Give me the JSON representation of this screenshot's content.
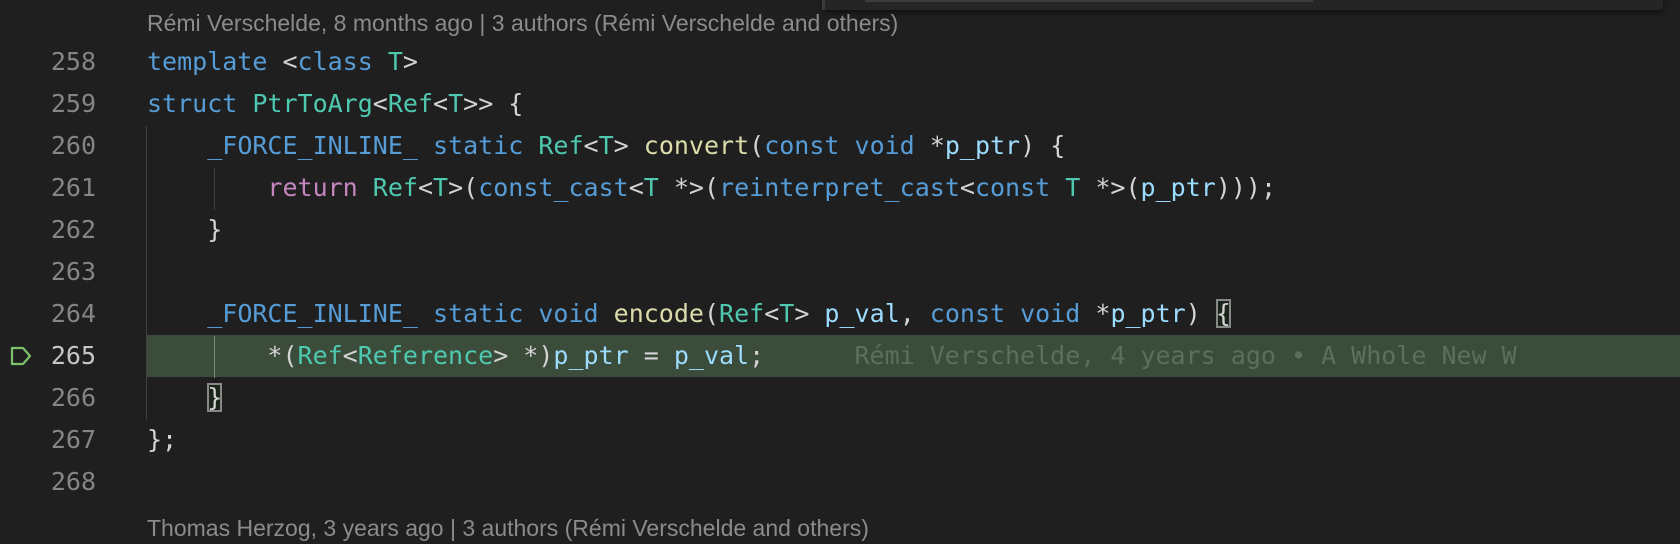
{
  "editor": {
    "blame_header_top": "Rémi Verschelde, 8 months ago | 3 authors (Rémi Verschelde and others)",
    "blame_header_bottom": "Thomas Herzog, 3 years ago | 3 authors (Rémi Verschelde and others)",
    "inline_blame": "Rémi Verschelde, 4 years ago • A Whole New W",
    "current_line": 265,
    "colors": {
      "background": "#1f1f1f",
      "highlight_line": "#3b4c3a",
      "keyword": "#569cd6",
      "type": "#4ec9b0",
      "function": "#dcdcaa",
      "control": "#c586c0",
      "variable": "#9cdcfe",
      "gutter_indicator": "#7ec16e"
    },
    "lines": [
      {
        "number": "258",
        "tokens": [
          [
            "kw",
            "template"
          ],
          [
            "pn",
            " <"
          ],
          [
            "kw",
            "class"
          ],
          [
            "pn",
            " "
          ],
          [
            "ty",
            "T"
          ],
          [
            "pn",
            ">"
          ]
        ]
      },
      {
        "number": "259",
        "tokens": [
          [
            "kw",
            "struct"
          ],
          [
            "pn",
            " "
          ],
          [
            "ty",
            "PtrToArg"
          ],
          [
            "pn",
            "<"
          ],
          [
            "ty",
            "Ref"
          ],
          [
            "pn",
            "<"
          ],
          [
            "ty",
            "T"
          ],
          [
            "pn",
            ">> {"
          ]
        ]
      },
      {
        "number": "260",
        "tokens": [
          [
            "pn",
            "    "
          ],
          [
            "kw",
            "_FORCE_INLINE_"
          ],
          [
            "pn",
            " "
          ],
          [
            "kw",
            "static"
          ],
          [
            "pn",
            " "
          ],
          [
            "ty",
            "Ref"
          ],
          [
            "pn",
            "<"
          ],
          [
            "ty",
            "T"
          ],
          [
            "pn",
            "> "
          ],
          [
            "fn",
            "convert"
          ],
          [
            "pn",
            "("
          ],
          [
            "kw",
            "const"
          ],
          [
            "pn",
            " "
          ],
          [
            "kw",
            "void"
          ],
          [
            "pn",
            " *"
          ],
          [
            "var",
            "p_ptr"
          ],
          [
            "pn",
            ") {"
          ]
        ]
      },
      {
        "number": "261",
        "tokens": [
          [
            "pn",
            "        "
          ],
          [
            "ctl",
            "return"
          ],
          [
            "pn",
            " "
          ],
          [
            "ty",
            "Ref"
          ],
          [
            "pn",
            "<"
          ],
          [
            "ty",
            "T"
          ],
          [
            "pn",
            ">("
          ],
          [
            "kw",
            "const_cast"
          ],
          [
            "pn",
            "<"
          ],
          [
            "ty",
            "T"
          ],
          [
            "pn",
            " *>("
          ],
          [
            "kw",
            "reinterpret_cast"
          ],
          [
            "pn",
            "<"
          ],
          [
            "kw",
            "const"
          ],
          [
            "pn",
            " "
          ],
          [
            "ty",
            "T"
          ],
          [
            "pn",
            " *>("
          ],
          [
            "var",
            "p_ptr"
          ],
          [
            "pn",
            ")));"
          ]
        ]
      },
      {
        "number": "262",
        "tokens": [
          [
            "pn",
            "    }"
          ]
        ]
      },
      {
        "number": "263",
        "tokens": []
      },
      {
        "number": "264",
        "tokens": [
          [
            "pn",
            "    "
          ],
          [
            "kw",
            "_FORCE_INLINE_"
          ],
          [
            "pn",
            " "
          ],
          [
            "kw",
            "static"
          ],
          [
            "pn",
            " "
          ],
          [
            "kw",
            "void"
          ],
          [
            "pn",
            " "
          ],
          [
            "fn",
            "encode"
          ],
          [
            "pn",
            "("
          ],
          [
            "ty",
            "Ref"
          ],
          [
            "pn",
            "<"
          ],
          [
            "ty",
            "T"
          ],
          [
            "pn",
            "> "
          ],
          [
            "var",
            "p_val"
          ],
          [
            "pn",
            ", "
          ],
          [
            "kw",
            "const"
          ],
          [
            "pn",
            " "
          ],
          [
            "kw",
            "void"
          ],
          [
            "pn",
            " *"
          ],
          [
            "var",
            "p_ptr"
          ],
          [
            "pn",
            ") "
          ],
          [
            "box",
            "{"
          ]
        ]
      },
      {
        "number": "265",
        "tokens": [
          [
            "pn",
            "        *("
          ],
          [
            "ty",
            "Ref"
          ],
          [
            "pn",
            "<"
          ],
          [
            "ty",
            "Reference"
          ],
          [
            "pn",
            "> *)"
          ],
          [
            "var",
            "p_ptr"
          ],
          [
            "pn",
            " = "
          ],
          [
            "var",
            "p_val"
          ],
          [
            "pn",
            ";"
          ]
        ]
      },
      {
        "number": "266",
        "tokens": [
          [
            "pn",
            "    "
          ],
          [
            "box",
            "}"
          ]
        ]
      },
      {
        "number": "267",
        "tokens": [
          [
            "pn",
            "};"
          ]
        ]
      },
      {
        "number": "268",
        "tokens": []
      }
    ]
  }
}
